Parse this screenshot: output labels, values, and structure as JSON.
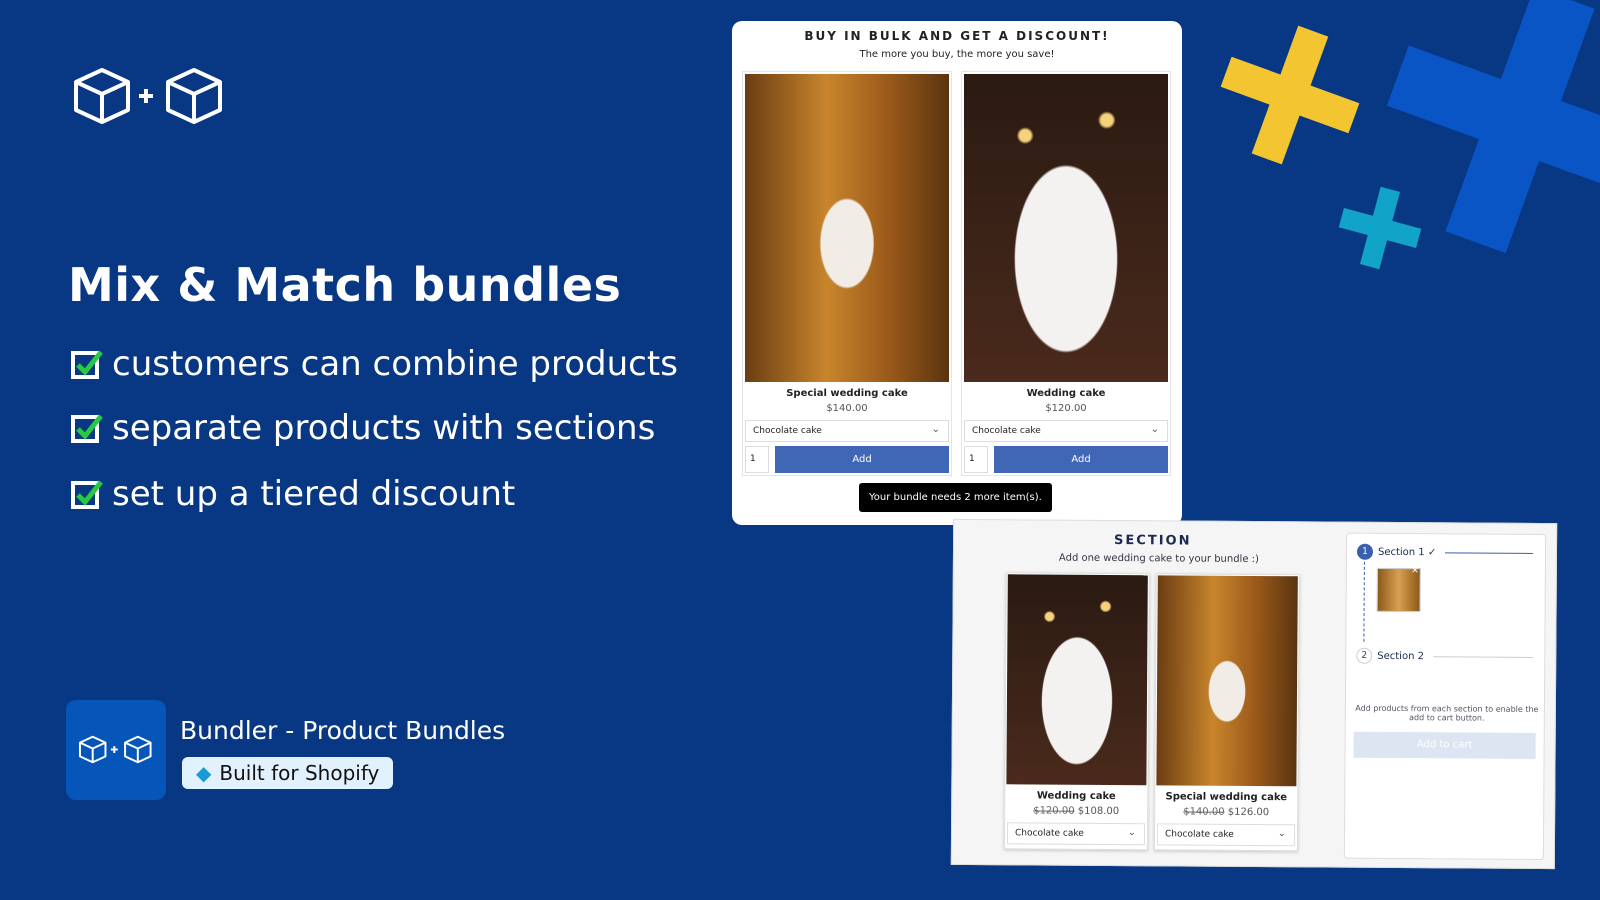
{
  "hero": {
    "title": "Mix & Match bundles",
    "features": [
      "customers can combine products",
      "separate products with sections",
      "set up a tiered discount"
    ]
  },
  "app": {
    "name": "Bundler - Product Bundles",
    "badge": "Built for Shopify",
    "badge_icon": "diamond-icon"
  },
  "colors": {
    "background": "#083783",
    "accent_yellow": "#f2c531",
    "accent_cyan": "#12a3c9",
    "accent_blue": "#0a55c6",
    "button": "#4067b5"
  },
  "bulk": {
    "heading": "BUY IN BULK AND GET A DISCOUNT!",
    "subheading": "The more you buy, the more you save!",
    "products": [
      {
        "name": "Special wedding cake",
        "price": "$140.00",
        "variant": "Chocolate cake",
        "qty": "1",
        "add": "Add"
      },
      {
        "name": "Wedding cake",
        "price": "$120.00",
        "variant": "Chocolate cake",
        "qty": "1",
        "add": "Add"
      }
    ],
    "toast": "Your bundle needs 2 more item(s)."
  },
  "section": {
    "heading": "SECTION",
    "subheading": "Add one wedding cake to your bundle :)",
    "products": [
      {
        "name": "Wedding cake",
        "old_price": "$120.00",
        "price": "$108.00",
        "variant": "Chocolate cake"
      },
      {
        "name": "Special wedding cake",
        "old_price": "$140.00",
        "price": "$126.00",
        "variant": "Chocolate cake"
      }
    ],
    "steps": [
      {
        "num": "1",
        "label": "Section 1 ✓"
      },
      {
        "num": "2",
        "label": "Section 2"
      }
    ],
    "note": "Add products from each section to enable the add to cart button.",
    "add_to_cart": "Add to cart"
  }
}
